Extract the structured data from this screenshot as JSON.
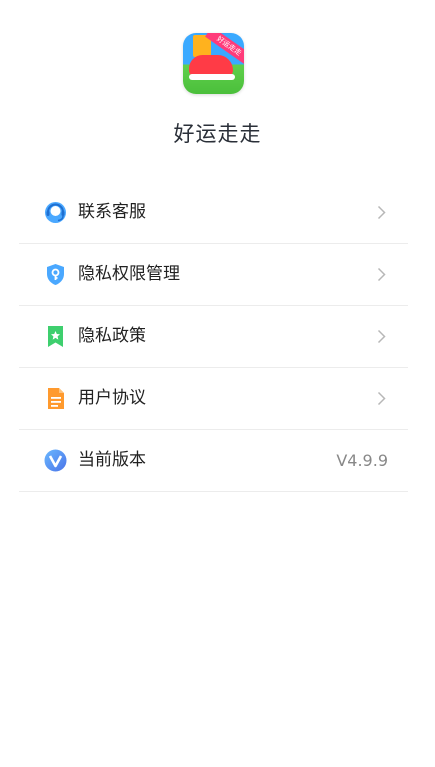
{
  "app": {
    "name": "好运走走",
    "icon_ribbon": "好运走走"
  },
  "menu": {
    "items": [
      {
        "label": "联系客服",
        "icon": "headset-icon"
      },
      {
        "label": "隐私权限管理",
        "icon": "shield-key-icon"
      },
      {
        "label": "隐私政策",
        "icon": "bookmark-star-icon"
      },
      {
        "label": "用户协议",
        "icon": "document-icon"
      },
      {
        "label": "当前版本",
        "icon": "version-v-icon",
        "value": "V4.9.9"
      }
    ]
  },
  "colors": {
    "text": "#222222",
    "muted": "#888888",
    "divider": "#ececec",
    "blue": "#4aa8ff",
    "green": "#3ecf6e",
    "orange": "#ff9a2e"
  }
}
